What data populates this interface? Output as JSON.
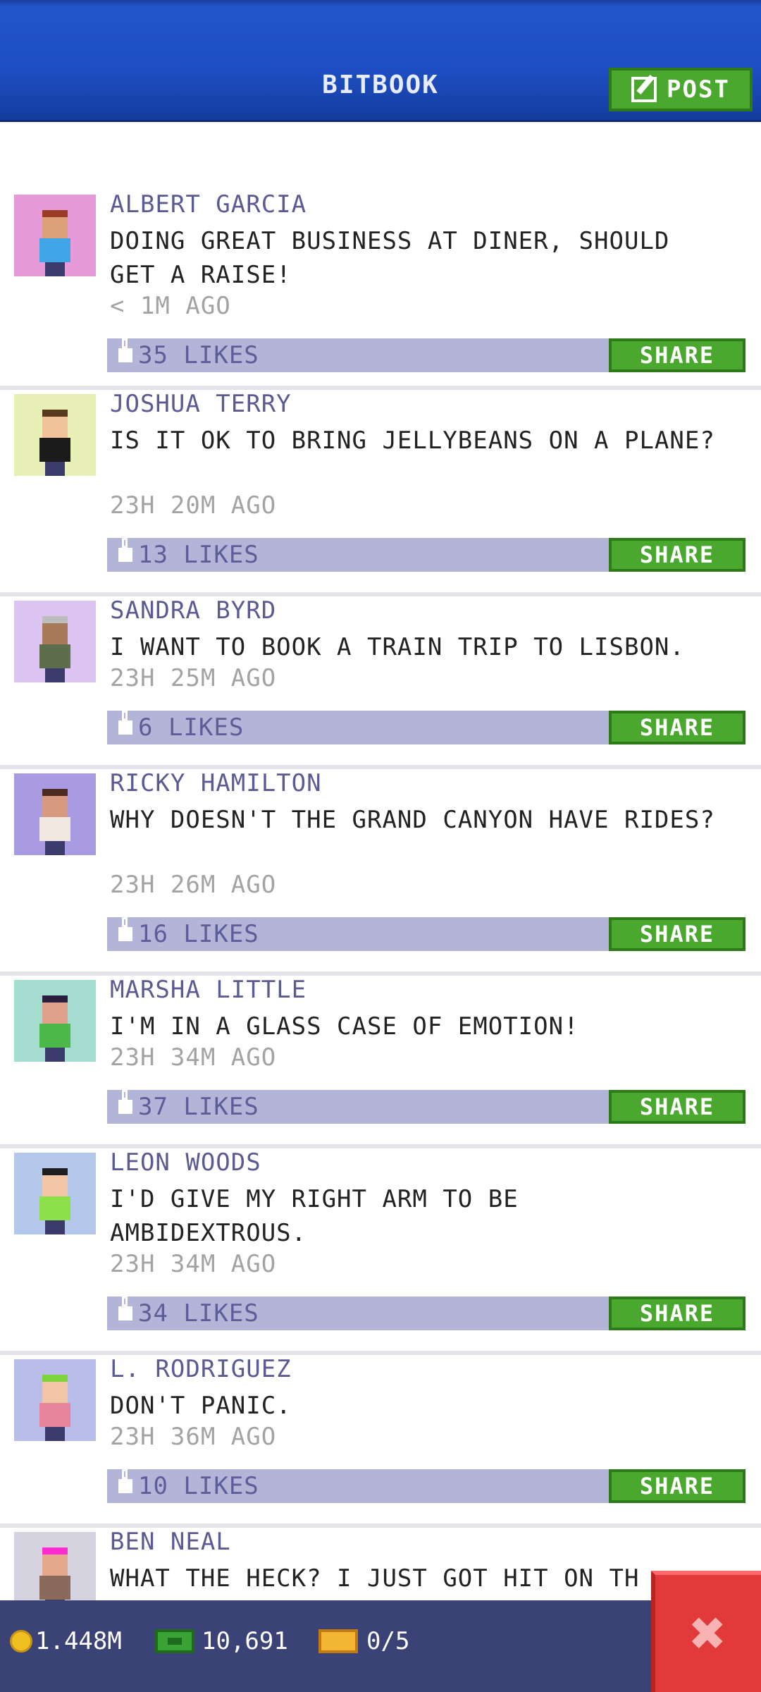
{
  "header": {
    "title": "BITBOOK",
    "post_label": "POST"
  },
  "posts": [
    {
      "name": "ALBERT GARCIA",
      "message": "DOING GREAT BUSINESS AT DINER, SHOULD GET A RAISE!",
      "time": "< 1M AGO",
      "likes": "35 LIKES",
      "share": "SHARE",
      "bg": "#e69ad8",
      "hair": "#9b3b24",
      "shirt": "#3fa5e6",
      "skin": "#dca07a"
    },
    {
      "name": "JOSHUA TERRY",
      "message": "IS IT OK TO BRING JELLYBEANS ON A PLANE?",
      "time": "23H 20M AGO",
      "likes": "13 LIKES",
      "share": "SHARE",
      "bg": "#e8f0b8",
      "hair": "#5a3a1e",
      "shirt": "#1b1b1b",
      "skin": "#f2c29a"
    },
    {
      "name": "SANDRA BYRD",
      "message": "I WANT TO BOOK A TRAIN TRIP TO LISBON.",
      "time": "23H 25M AGO",
      "likes": "6 LIKES",
      "share": "SHARE",
      "bg": "#dcc4f2",
      "hair": "#bdbdbd",
      "shirt": "#5c6e4c",
      "skin": "#a87a5a"
    },
    {
      "name": "RICKY HAMILTON",
      "message": "WHY DOESN'T THE GRAND CANYON HAVE RIDES?",
      "time": "23H 26M AGO",
      "likes": "16 LIKES",
      "share": "SHARE",
      "bg": "#a99be2",
      "hair": "#4b2b1e",
      "shirt": "#f1e6e0",
      "skin": "#d79a80"
    },
    {
      "name": "MARSHA LITTLE",
      "message": "I'M IN A GLASS CASE OF EMOTION!",
      "time": "23H 34M AGO",
      "likes": "37 LIKES",
      "share": "SHARE",
      "bg": "#a5dcd0",
      "hair": "#2a1e3e",
      "shirt": "#4cb84a",
      "skin": "#e0a08c"
    },
    {
      "name": "LEON WOODS",
      "message": "I'D GIVE MY RIGHT ARM TO BE AMBIDEXTROUS.",
      "time": "23H 34M AGO",
      "likes": "34 LIKES",
      "share": "SHARE",
      "bg": "#b4c8ec",
      "hair": "#1f1f1f",
      "shirt": "#8ce04a",
      "skin": "#f0c6a6"
    },
    {
      "name": "L. RODRIGUEZ",
      "message": "DON'T PANIC.",
      "time": "23H 36M AGO",
      "likes": "10 LIKES",
      "share": "SHARE",
      "bg": "#b9bdea",
      "hair": "#7ad43a",
      "shirt": "#e8849c",
      "skin": "#f0c6a6"
    },
    {
      "name": "BEN NEAL",
      "message": "WHAT THE HECK? I JUST GOT HIT ON TH",
      "time": "",
      "likes": "",
      "share": "",
      "bg": "#d6d3e0",
      "hair": "#ff2bd0",
      "shirt": "#8a6a5a",
      "skin": "#e4a88c"
    }
  ],
  "footer": {
    "coins": "1.448M",
    "bux": "10,691",
    "tickets": "0/5",
    "close_glyph": "✖"
  }
}
